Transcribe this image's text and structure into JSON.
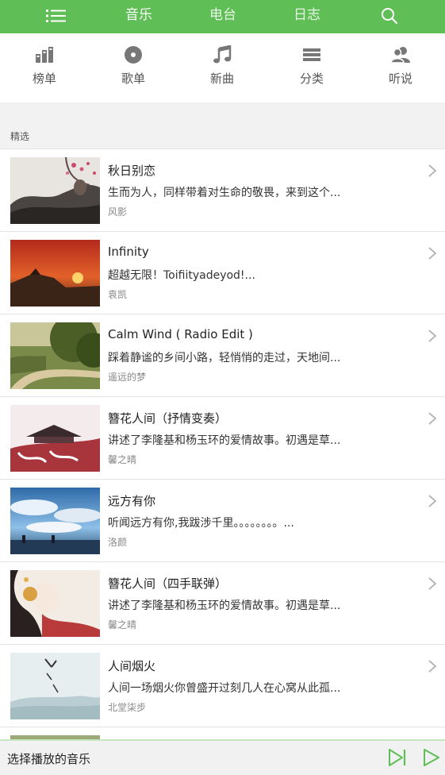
{
  "topbar": {
    "tabs": [
      "音乐",
      "电台",
      "日志"
    ],
    "menu_icon": "list-menu-icon",
    "search_icon": "search-icon",
    "active_tab": "音乐",
    "accent": "#5fbe56"
  },
  "categories": [
    {
      "label": "榜单",
      "icon": "ranking-bars-icon"
    },
    {
      "label": "歌单",
      "icon": "disc-icon"
    },
    {
      "label": "新曲",
      "icon": "music-note-icon"
    },
    {
      "label": "分类",
      "icon": "stack-layers-icon"
    },
    {
      "label": "听说",
      "icon": "people-icon"
    }
  ],
  "section": {
    "label": "精选"
  },
  "songs": [
    {
      "title": "秋日别恋",
      "desc": "生而为人，同样带着对生命的敬畏，来到这个...",
      "author": "风影"
    },
    {
      "title": "Infinity",
      "desc": "超越无限！Toifiityadeyod!...",
      "author": "袁凯"
    },
    {
      "title": "Calm Wind ( Radio Edit )",
      "desc": "踩着静谧的乡间小路，轻悄悄的走过，天地间...",
      "author": "遥远的梦"
    },
    {
      "title": "簪花人间（抒情变奏）",
      "desc": "讲述了李隆基和杨玉环的爱情故事。初遇是草...",
      "author": "馨之晴"
    },
    {
      "title": "远方有你",
      "desc": "听闻远方有你,我跋涉千里。。。。。。。。...",
      "author": "洛颜"
    },
    {
      "title": "簪花人间（四手联弹）",
      "desc": "讲述了李隆基和杨玉环的爱情故事。初遇是草...",
      "author": "馨之晴"
    },
    {
      "title": "人间烟火",
      "desc": "人间一场烟火你曾盛开过刻几人在心窝从此孤...",
      "author": "北堂柒步"
    }
  ],
  "player": {
    "label": "选择播放的音乐",
    "next_icon": "skip-next-icon",
    "play_icon": "play-icon"
  }
}
